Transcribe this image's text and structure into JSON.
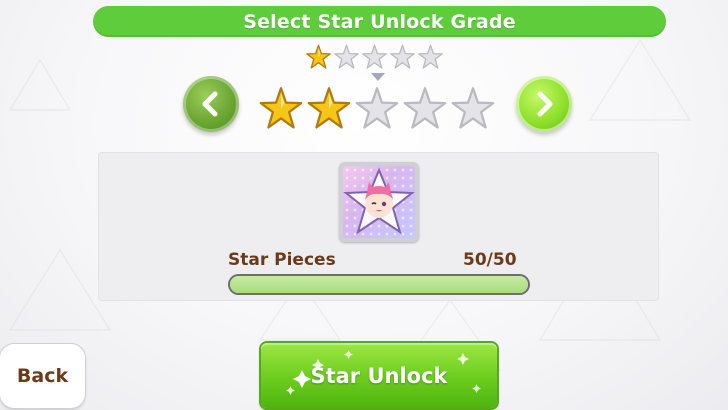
{
  "header": {
    "title": "Select Star Unlock Grade"
  },
  "current_grade": {
    "stars_filled": 1,
    "stars_total": 5
  },
  "target_grade": {
    "stars_filled": 2,
    "stars_total": 5
  },
  "item": {
    "icon": "character-star-piece-icon",
    "label": "Star Pieces",
    "count_text": "50/50",
    "progress": 1.0
  },
  "buttons": {
    "prev_icon": "chevron-left-icon",
    "next_icon": "chevron-right-icon",
    "back_label": "Back",
    "unlock_label": "Star Unlock"
  },
  "colors": {
    "accent_green": "#5fcc3c",
    "star_gold": "#f5c518",
    "star_empty": "#e4e4e8",
    "label_brown": "#6b3a1a"
  }
}
